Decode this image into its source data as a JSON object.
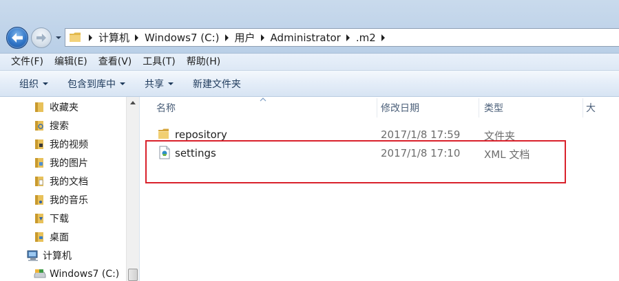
{
  "address_bar": {
    "crumbs": [
      "计算机",
      "Windows7 (C:)",
      "用户",
      "Administrator",
      ".m2"
    ]
  },
  "menu_bar": {
    "items": [
      "文件(F)",
      "编辑(E)",
      "查看(V)",
      "工具(T)",
      "帮助(H)"
    ]
  },
  "command_bar": {
    "organize": "组织",
    "include_in_library": "包含到库中",
    "share": "共享",
    "new_folder": "新建文件夹"
  },
  "nav_pane": {
    "items": [
      {
        "label": "收藏夹",
        "icon": "star-folder-icon"
      },
      {
        "label": "搜索",
        "icon": "search-folder-icon"
      },
      {
        "label": "我的视频",
        "icon": "video-folder-icon"
      },
      {
        "label": "我的图片",
        "icon": "pictures-folder-icon"
      },
      {
        "label": "我的文档",
        "icon": "documents-folder-icon"
      },
      {
        "label": "我的音乐",
        "icon": "music-folder-icon"
      },
      {
        "label": "下载",
        "icon": "downloads-folder-icon"
      },
      {
        "label": "桌面",
        "icon": "desktop-folder-icon"
      },
      {
        "label": "计算机",
        "icon": "computer-icon"
      },
      {
        "label": "Windows7 (C:)",
        "icon": "drive-icon"
      }
    ]
  },
  "file_list": {
    "columns": {
      "name": "名称",
      "modified": "修改日期",
      "type": "类型",
      "size": "大"
    },
    "rows": [
      {
        "name": "repository",
        "modified": "2017/1/8 17:59",
        "type": "文件夹",
        "icon": "folder-icon"
      },
      {
        "name": "settings",
        "modified": "2017/1/8 17:10",
        "type": "XML 文档",
        "icon": "xml-file-icon"
      }
    ]
  },
  "colors": {
    "highlight_border": "#d9202a",
    "folder_yellow": "#e8c15a",
    "header_text": "#4c607a"
  }
}
